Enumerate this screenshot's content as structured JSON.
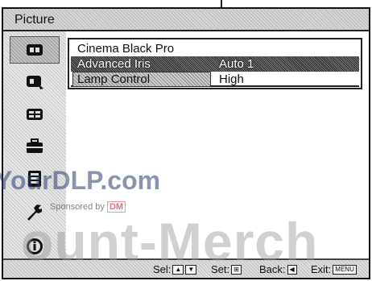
{
  "header": {
    "title": "Picture"
  },
  "sidebar": {
    "items": [
      {
        "icon": "picture-menu-icon",
        "active": true
      },
      {
        "icon": "picture-adjust-icon",
        "active": false
      },
      {
        "icon": "screen-icon",
        "active": false
      },
      {
        "icon": "setup-icon",
        "active": false
      },
      {
        "icon": "function-icon",
        "active": false
      },
      {
        "icon": "wrench-icon",
        "active": false
      },
      {
        "icon": "info-icon",
        "active": false
      }
    ]
  },
  "menu": {
    "rows": [
      {
        "label": "Cinema Black Pro",
        "value": ""
      },
      {
        "label": "Advanced Iris",
        "value": "Auto 1"
      },
      {
        "label": "Lamp Control",
        "value": "High"
      }
    ]
  },
  "footer": {
    "sel_label": "Sel:",
    "set_label": "Set:",
    "back_label": "Back:",
    "exit_label": "Exit:",
    "menu_key": "MENU"
  },
  "watermarks": {
    "site": "YourDLP.com",
    "sponsored": "Sponsored by",
    "sponsor_logo": "DM",
    "bottom": "ount-Merch"
  }
}
